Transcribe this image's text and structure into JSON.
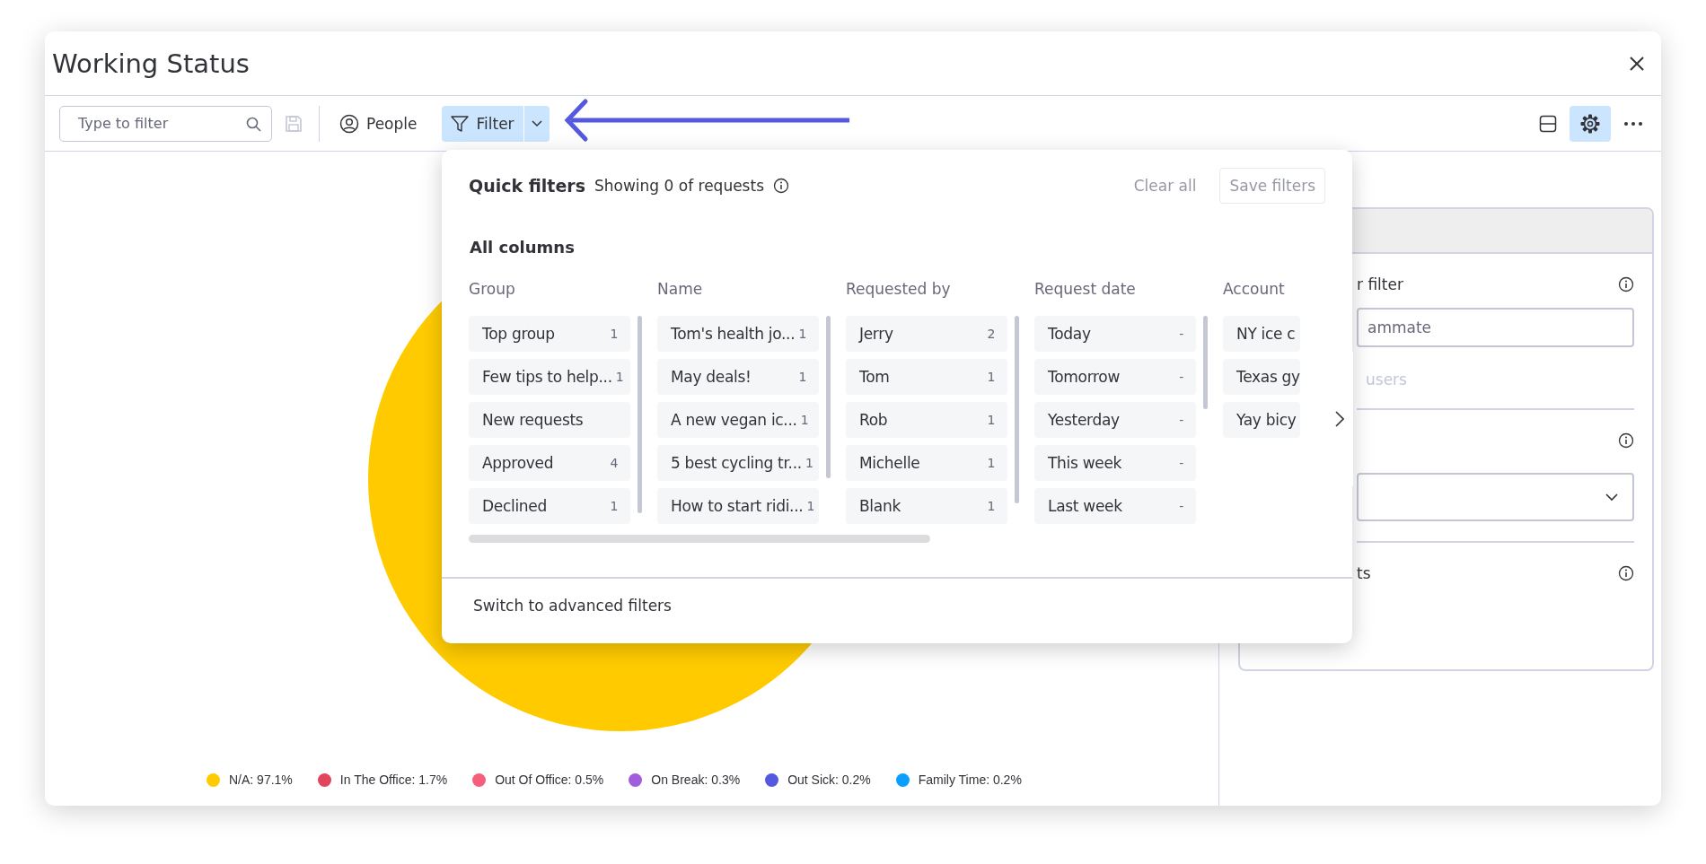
{
  "window": {
    "title": "Working Status"
  },
  "toolbar": {
    "search": {
      "placeholder": "Type to filter"
    },
    "people_label": "People",
    "filter_label": "Filter"
  },
  "quick_filters": {
    "title": "Quick filters",
    "summary": "Showing 0 of requests",
    "clear_label": "Clear all",
    "save_label": "Save filters",
    "section": "All columns",
    "columns": [
      {
        "title": "Group",
        "options": [
          {
            "label": "Top group",
            "count": "1"
          },
          {
            "label": "Few tips to help...",
            "count": "1"
          },
          {
            "label": "New requests"
          },
          {
            "label": "Approved",
            "count": "4"
          },
          {
            "label": "Declined",
            "count": "1"
          }
        ]
      },
      {
        "title": "Name",
        "options": [
          {
            "label": "Tom's health jo...",
            "count": "1"
          },
          {
            "label": "May deals!",
            "count": "1"
          },
          {
            "label": "A new vegan ic...",
            "count": "1"
          },
          {
            "label": "5 best cycling tr...",
            "count": "1"
          },
          {
            "label": "How to start ridi...",
            "count": "1"
          }
        ]
      },
      {
        "title": "Requested by",
        "options": [
          {
            "label": "Jerry",
            "count": "2"
          },
          {
            "label": "Tom",
            "count": "1"
          },
          {
            "label": "Rob",
            "count": "1"
          },
          {
            "label": "Michelle",
            "count": "1"
          },
          {
            "label": "Blank",
            "count": "1"
          }
        ]
      },
      {
        "title": "Request date",
        "options": [
          {
            "label": "Today",
            "count": "-"
          },
          {
            "label": "Tomorrow",
            "count": "-"
          },
          {
            "label": "Yesterday",
            "count": "-"
          },
          {
            "label": "This week",
            "count": "-"
          },
          {
            "label": "Last week",
            "count": "-"
          }
        ]
      },
      {
        "title": "Account",
        "options": [
          {
            "label": "NY ice c"
          },
          {
            "label": "Texas gy"
          },
          {
            "label": "Yay bicy"
          }
        ]
      }
    ],
    "footer_link": "Switch to advanced filters"
  },
  "settings_panel": {
    "filter_label": "r filter",
    "search_placeholder": "ammate",
    "users_label": "users",
    "section_label": "ts"
  },
  "chart": {
    "legend": [
      {
        "label": "N/A: 97.1%",
        "color": "#ffcb00"
      },
      {
        "label": "In The Office: 1.7%",
        "color": "#e2445c"
      },
      {
        "label": "Out Of Office: 0.5%",
        "color": "#f65f7c"
      },
      {
        "label": "On Break: 0.3%",
        "color": "#a25ddc"
      },
      {
        "label": "Out Sick: 0.2%",
        "color": "#5559df"
      },
      {
        "label": "Family Time: 0.2%",
        "color": "#0a9eff"
      }
    ]
  }
}
